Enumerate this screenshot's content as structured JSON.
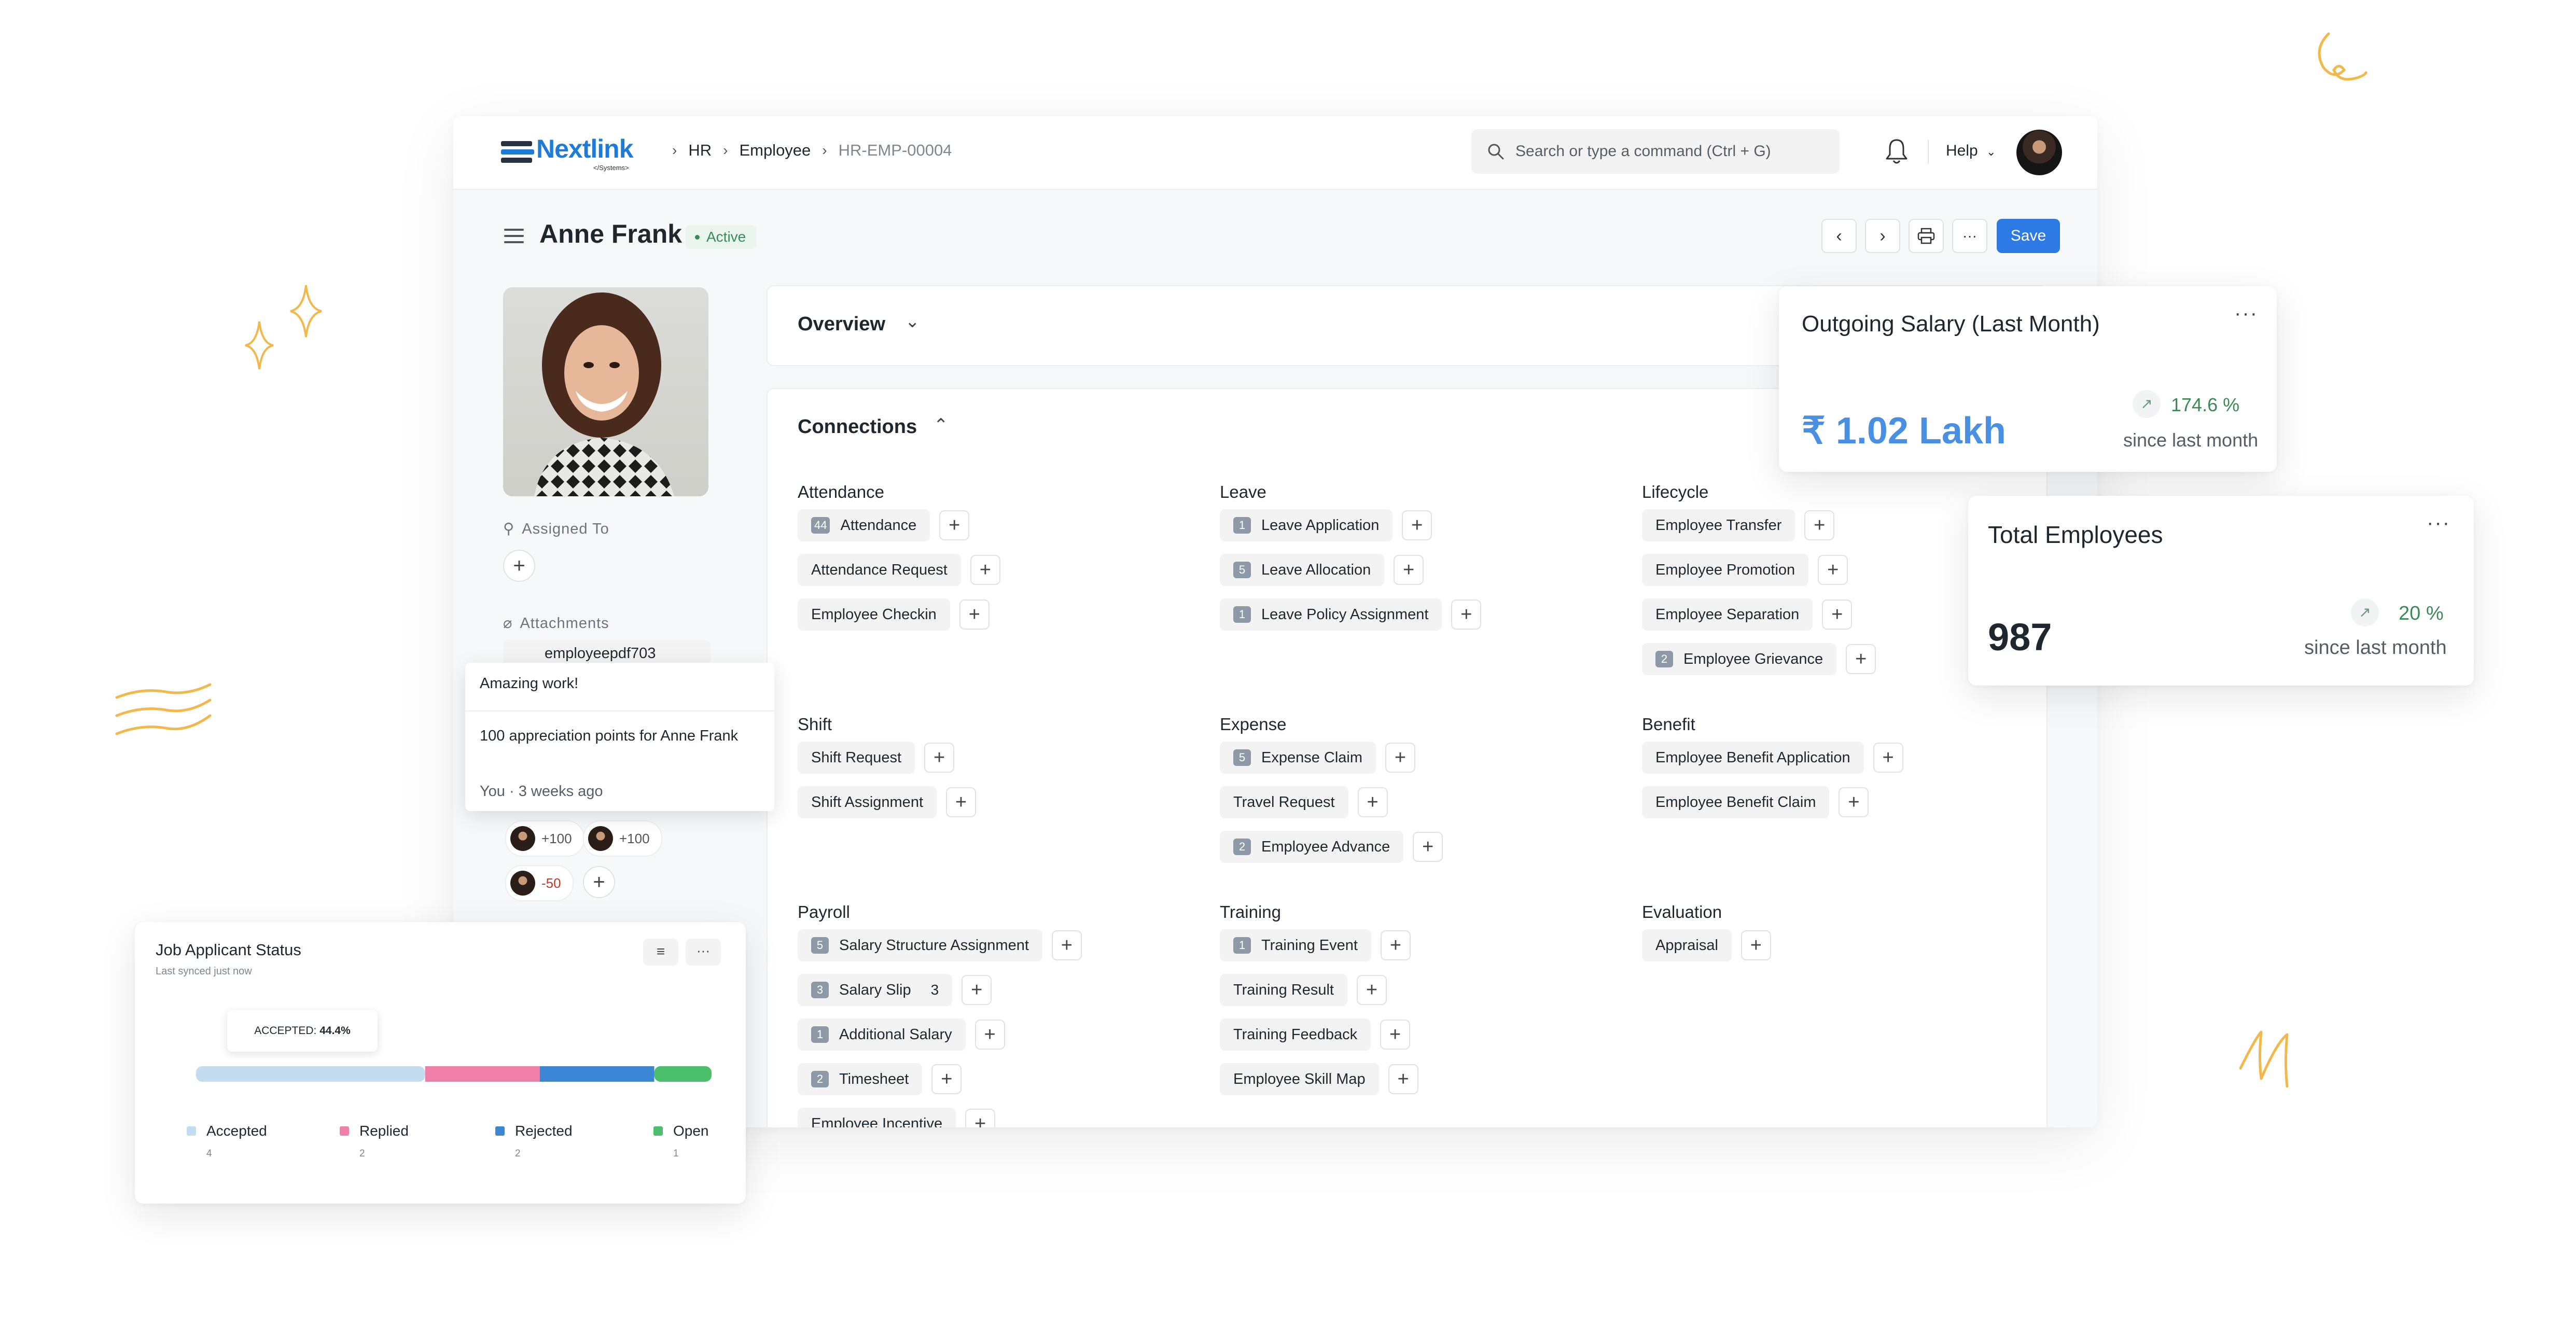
{
  "colors": {
    "accent": "#2d7ae5",
    "big_number_blue": "#4a90e2",
    "accepted": "#c4dcf0",
    "replied": "#ef7ea8",
    "rejected": "#3d86d4",
    "open": "#4bbf6b"
  },
  "logo": {
    "name": "Nextlink",
    "sub": "</Systems>"
  },
  "breadcrumb": [
    "HR",
    "Employee",
    "HR-EMP-00004"
  ],
  "search": {
    "placeholder": "Search or type a command (Ctrl + G)"
  },
  "navbar": {
    "help_label": "Help"
  },
  "page": {
    "title": "Anne Frank",
    "status": "Active",
    "save_label": "Save"
  },
  "sidebar": {
    "assigned_to_label": "Assigned To",
    "attachments_label": "Attachments",
    "attachment_file": "employeepdf703",
    "appreciations": [
      "+100",
      "+100",
      "-50"
    ]
  },
  "toast": {
    "title": "Amazing work!",
    "message": "100 appreciation points for Anne Frank",
    "meta": "You · 3 weeks ago"
  },
  "overview": {
    "label": "Overview"
  },
  "connections": {
    "label": "Connections",
    "groups": [
      {
        "title": "Attendance",
        "items": [
          {
            "label": "Attendance",
            "count": "44"
          },
          {
            "label": "Attendance Request"
          },
          {
            "label": "Employee Checkin"
          }
        ]
      },
      {
        "title": "Leave",
        "items": [
          {
            "label": "Leave Application",
            "count": "1"
          },
          {
            "label": "Leave Allocation",
            "count": "5"
          },
          {
            "label": "Leave Policy Assignment",
            "count": "1"
          }
        ]
      },
      {
        "title": "Lifecycle",
        "items": [
          {
            "label": "Employee Transfer"
          },
          {
            "label": "Employee Promotion"
          },
          {
            "label": "Employee Separation"
          },
          {
            "label": "Employee Grievance",
            "count": "2"
          }
        ]
      },
      {
        "title": "Shift",
        "items": [
          {
            "label": "Shift Request"
          },
          {
            "label": "Shift Assignment"
          }
        ]
      },
      {
        "title": "Expense",
        "items": [
          {
            "label": "Expense Claim",
            "count": "5"
          },
          {
            "label": "Travel Request"
          },
          {
            "label": "Employee Advance",
            "count": "2"
          }
        ]
      },
      {
        "title": "Benefit",
        "items": [
          {
            "label": "Employee Benefit Application"
          },
          {
            "label": "Employee Benefit Claim"
          }
        ]
      },
      {
        "title": "Payroll",
        "items": [
          {
            "label": "Salary Structure Assignment",
            "count": "5"
          },
          {
            "label": "Salary Slip",
            "count": "3",
            "extra": "3"
          },
          {
            "label": "Additional Salary",
            "count": "1"
          },
          {
            "label": "Timesheet",
            "count": "2"
          },
          {
            "label": "Employee Incentive"
          }
        ]
      },
      {
        "title": "Training",
        "items": [
          {
            "label": "Training Event",
            "count": "1"
          },
          {
            "label": "Training Result"
          },
          {
            "label": "Training Feedback"
          },
          {
            "label": "Employee Skill Map"
          }
        ]
      },
      {
        "title": "Evaluation",
        "items": [
          {
            "label": "Appraisal"
          }
        ]
      }
    ]
  },
  "salary_card": {
    "title": "Outgoing Salary (Last Month)",
    "value": "₹ 1.02 Lakh",
    "change": "174.6 %",
    "since": "since last month"
  },
  "employees_card": {
    "title": "Total Employees",
    "value": "987",
    "change": "20 %",
    "since": "since last month"
  },
  "job_card": {
    "title": "Job Applicant Status",
    "subtitle": "Last synced just now",
    "tooltip_label": "ACCEPTED:",
    "tooltip_value": "44.4%"
  },
  "chart_data": {
    "type": "bar",
    "title": "Job Applicant Status",
    "categories": [
      "Accepted",
      "Replied",
      "Rejected",
      "Open"
    ],
    "values": [
      4,
      2,
      2,
      1
    ],
    "stacked": true,
    "orientation": "horizontal",
    "legend": "bottom"
  }
}
